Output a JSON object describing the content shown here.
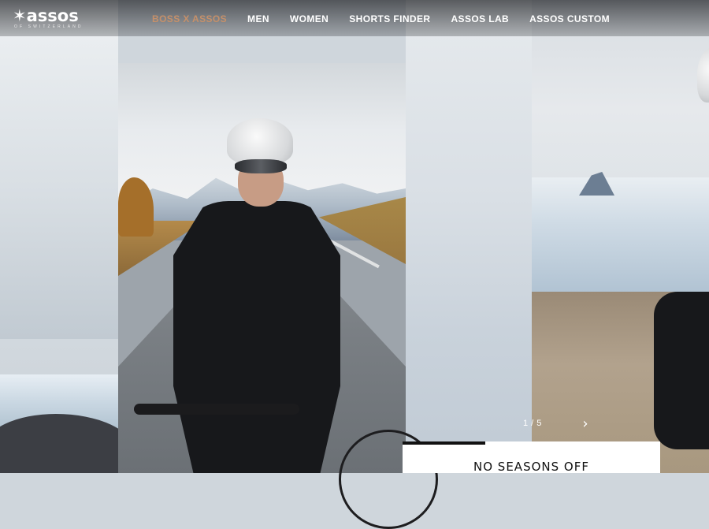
{
  "brand": {
    "wordmark": "assos",
    "tagline": "OF SWITZERLAND"
  },
  "nav": {
    "items": [
      {
        "label": "BOSS X ASSOS",
        "highlight": true
      },
      {
        "label": "MEN",
        "highlight": false
      },
      {
        "label": "WOMEN",
        "highlight": false
      },
      {
        "label": "SHORTS FINDER",
        "highlight": false
      },
      {
        "label": "ASSOS LAB",
        "highlight": false
      },
      {
        "label": "ASSOS CUSTOM",
        "highlight": false
      }
    ]
  },
  "carousel": {
    "counter": "1 / 5",
    "next_icon": "chevron-right-icon"
  },
  "caption": {
    "title": "NO SEASONS OFF"
  },
  "colors": {
    "nav_highlight": "#c5906a",
    "nav_text": "#ffffff",
    "caption_bg": "#ffffff",
    "caption_text": "#111111"
  }
}
